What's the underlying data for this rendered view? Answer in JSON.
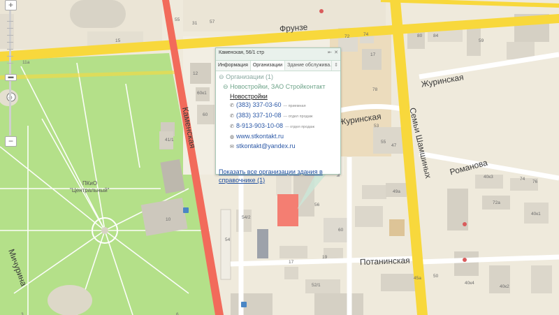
{
  "popup": {
    "title": "Каменская, 56/1 стр",
    "tabs": [
      "Информация",
      "Организации",
      "Здание обслужива..."
    ],
    "active_tab": "Организации",
    "org_header": "Организации (1)",
    "org_group": "Новостройки, ЗАО Стройконтакт",
    "org_name": "Новостройки",
    "contacts": [
      {
        "icon": "phone-icon",
        "value": "(383) 337-03-60",
        "note": "— приемная"
      },
      {
        "icon": "phone-icon",
        "value": "(383) 337-10-08",
        "note": "— отдел продаж"
      },
      {
        "icon": "phone-icon",
        "value": "8-913-903-10-08",
        "note": "— отдел продаж"
      },
      {
        "icon": "globe-icon",
        "value": "www.stkontakt.ru",
        "note": ""
      },
      {
        "icon": "mail-icon",
        "value": "stkontakt@yandex.ru",
        "note": ""
      }
    ],
    "show_all_link": "Показать все организации здания в справочнике",
    "show_all_count": "(1)"
  },
  "streets": {
    "frunze": "Фрунзе",
    "kamenskaya": "Каменская",
    "zhurinskaya_top": "Журинская",
    "zhurinskaya": "Журинская",
    "semyi_shamshinykh": "Семьи Шамшиных",
    "romanova": "Романова",
    "potaninskaya": "Потанинская",
    "michurina": "Мичурина"
  },
  "park": {
    "label_line1": "ПКиО",
    "label_line2": "\"Центральный\""
  },
  "building_numbers": [
    "57",
    "55",
    "31",
    "15",
    "11а",
    "12",
    "60к1",
    "60",
    "41/1",
    "10",
    "72",
    "74",
    "17",
    "78",
    "80",
    "84",
    "59",
    "53",
    "55",
    "47",
    "40к3",
    "74",
    "76",
    "72а",
    "40к1",
    "49а",
    "56",
    "54/2",
    "54",
    "17",
    "19",
    "60",
    "50",
    "52/1",
    "45а",
    "40к4",
    "40к2",
    "6",
    "3"
  ],
  "colors": {
    "park": "#b4e089",
    "main_road": "#f26b5b",
    "yellow_road": "#f8d83c",
    "selected_building": "#f47e72"
  }
}
